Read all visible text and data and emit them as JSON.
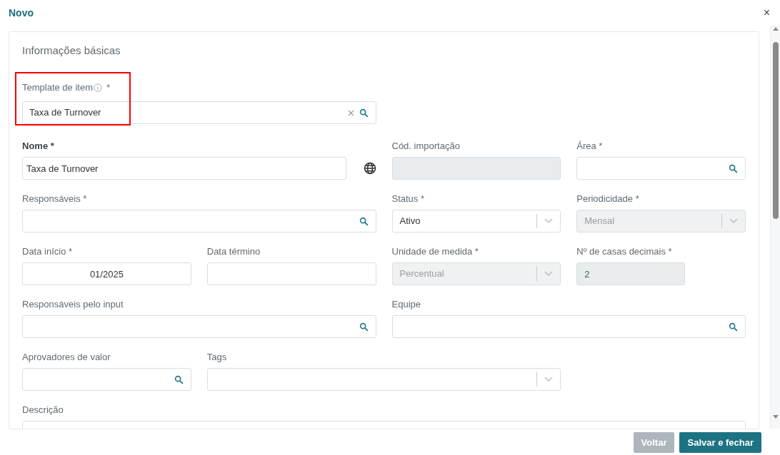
{
  "dialog": {
    "title": "Novo",
    "close": "×"
  },
  "section_title": "Informações básicas",
  "template": {
    "label": "Template de item",
    "required": "*",
    "value": "Taxa de Turnover",
    "highlighted": true
  },
  "fields": [
    {
      "kind": "localized_text",
      "label": "Nome *",
      "label_bold": true,
      "value": "Taxa de Turnover"
    },
    {
      "kind": "text",
      "label": "Cód. importação",
      "disabled": true
    },
    {
      "kind": "search",
      "label": "Área *"
    },
    {
      "kind": "search",
      "label": "Responsáveis *"
    },
    {
      "kind": "select",
      "label": "Status *",
      "value": "Ativo",
      "disabled": false
    },
    {
      "kind": "select",
      "label": "Periodicidade *",
      "value": "Mensal",
      "disabled": true
    },
    {
      "kind": "date",
      "label": "Data início *",
      "value": "01/2025"
    },
    {
      "kind": "date",
      "label": "Data término"
    },
    {
      "kind": "select",
      "label": "Unidade de medida *",
      "value": "Percentual",
      "disabled": true
    },
    {
      "kind": "number",
      "label": "Nº de casas decimais *",
      "value": "2",
      "disabled": true
    },
    {
      "kind": "search",
      "label": "Responsáveis pelo input"
    },
    {
      "kind": "search",
      "label": "Equipe"
    },
    {
      "kind": "search",
      "label": "Aprovadores de valor"
    },
    {
      "kind": "select",
      "label": "Tags",
      "disabled": false
    },
    {
      "kind": "textarea",
      "label": "Descrição"
    }
  ],
  "buttons": [
    {
      "label": "Voltar",
      "kind": "secondary"
    },
    {
      "label": "Salvar e fechar",
      "kind": "primary"
    }
  ]
}
